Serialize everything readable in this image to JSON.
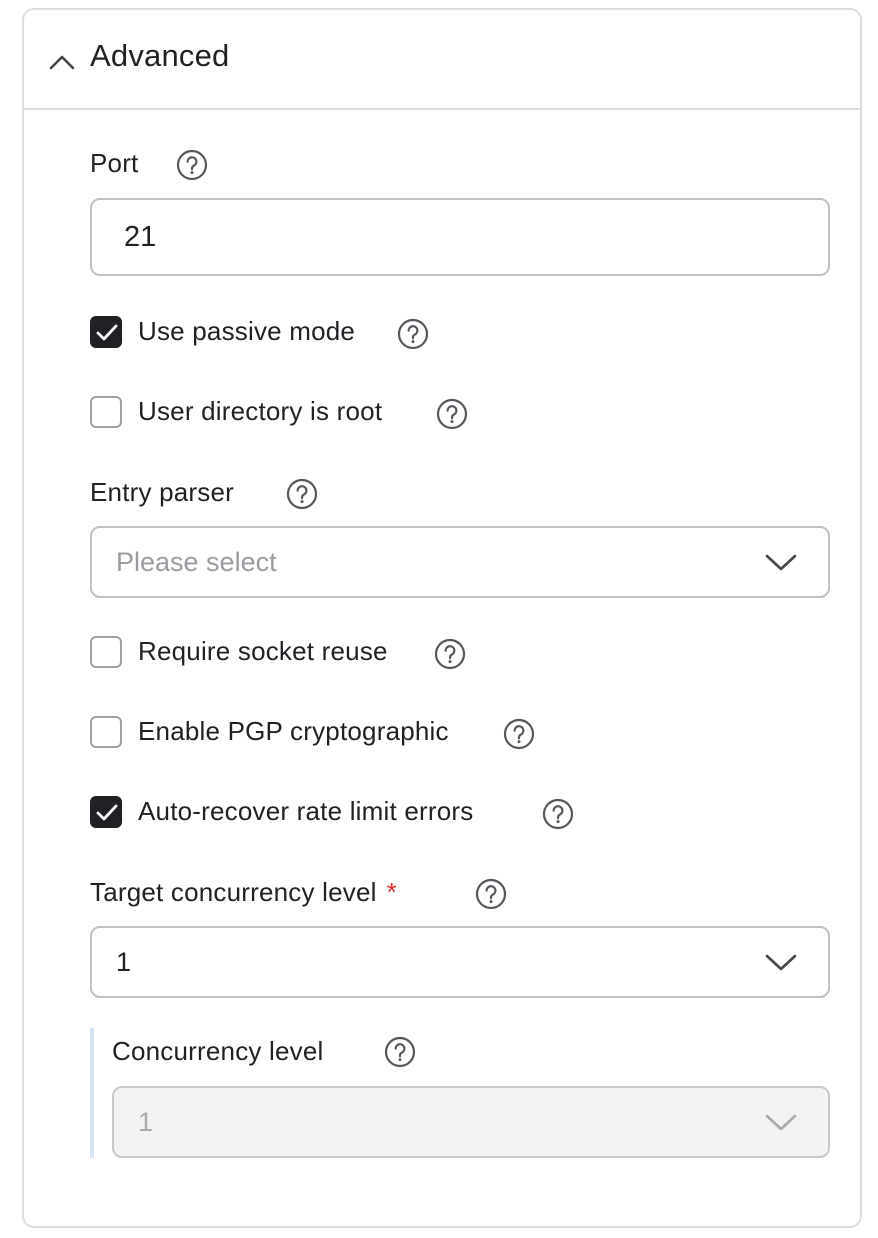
{
  "section": {
    "title": "Advanced",
    "toggle_icon": "chevron-up-icon"
  },
  "fields": {
    "port": {
      "label": "Port",
      "value": "21",
      "help_icon": "help-circle-icon"
    },
    "passive_mode": {
      "label": "Use passive mode",
      "checked": true
    },
    "user_dir_root": {
      "label": "User directory is root",
      "checked": false
    },
    "entry_parser": {
      "label": "Entry parser",
      "placeholder": "Please select",
      "dropdown_icon": "chevron-down-icon"
    },
    "socket_reuse": {
      "label": "Require socket reuse",
      "checked": false
    },
    "pgp": {
      "label": "Enable PGP cryptographic",
      "checked": false
    },
    "auto_recover": {
      "label": "Auto-recover rate limit errors",
      "checked": true
    },
    "target_concurrency": {
      "label": "Target concurrency level",
      "required_mark": "*",
      "value": "1"
    },
    "concurrency_level": {
      "label": "Concurrency level",
      "value": "1",
      "disabled": true
    }
  },
  "colors": {
    "required": "#e0322d",
    "checked_fill": "#1f2125",
    "border": "#bfc1c5",
    "subsection_bar": "#d6e4f3"
  }
}
